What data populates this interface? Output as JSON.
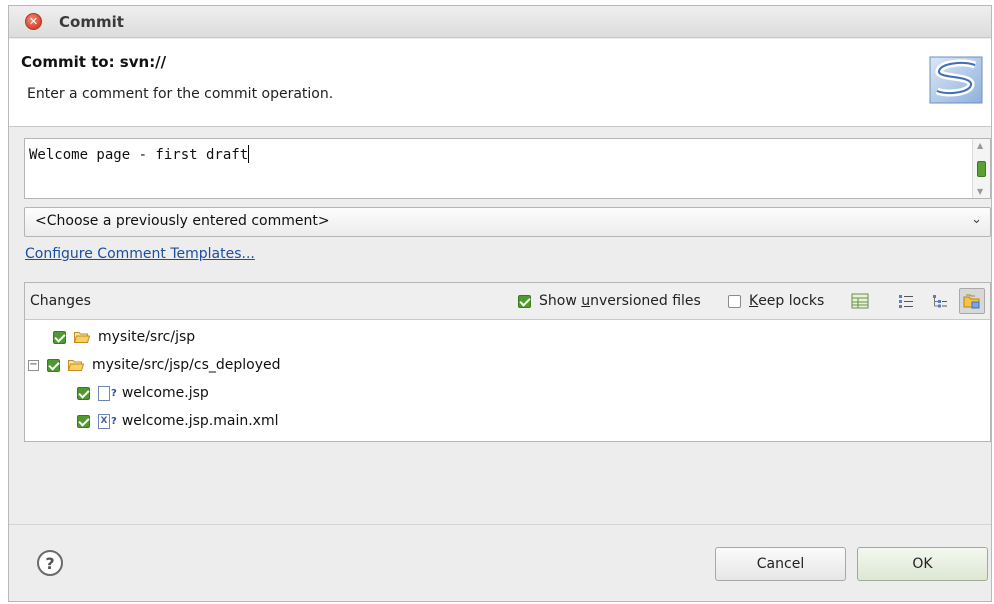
{
  "window": {
    "title": "Commit"
  },
  "header": {
    "title": "Commit to: svn://",
    "description": "Enter a comment for the commit operation."
  },
  "comment": {
    "value": "Welcome page - first draft"
  },
  "previous_comments": {
    "selected": "<Choose a previously entered comment>"
  },
  "templates_link": "Configure Comment Templates...",
  "changes": {
    "title": "Changes",
    "show_unversioned": {
      "prefix": "Show ",
      "mnemonic": "u",
      "rest": "nversioned files",
      "checked": true
    },
    "keep_locks": {
      "mnemonic": "K",
      "rest": "eep locks",
      "checked": false
    },
    "tree": [
      {
        "label": "mysite/src/jsp",
        "type": "folder",
        "checked": true,
        "expander": ""
      },
      {
        "label": "mysite/src/jsp/cs_deployed",
        "type": "folder",
        "checked": true,
        "expander": "−"
      },
      {
        "label": "welcome.jsp",
        "type": "jsp-file",
        "checked": true,
        "icon_letter": ""
      },
      {
        "label": "welcome.jsp.main.xml",
        "type": "xml-file",
        "checked": true,
        "icon_letter": "X"
      }
    ]
  },
  "buttons": {
    "cancel": "Cancel",
    "ok": "OK",
    "help": "?"
  },
  "colors": {
    "check_green": "#4f9a2c",
    "link_blue": "#1a4fa0",
    "close_red": "#d4452c"
  }
}
